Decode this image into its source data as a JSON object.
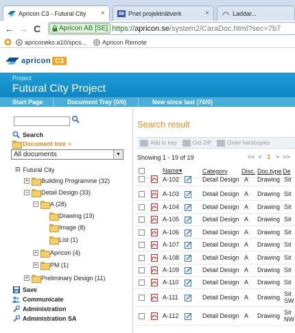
{
  "browser": {
    "tabs": [
      {
        "title": "Apricon C3 - Futural City",
        "close": "×",
        "active": true
      },
      {
        "title": "Pnet projektnätverk",
        "close": "×",
        "active": false
      },
      {
        "title": "Laddar...",
        "close": "",
        "active": false
      }
    ],
    "nav": {
      "back": "←",
      "forward": "→",
      "reload": "C"
    },
    "security_label": "Apricon AB [SE]",
    "url_prefix": "https://",
    "url_host": "apricon.se",
    "url_rest": "/system2/CaraDoc.html?sec=7b7",
    "bookmarks": [
      {
        "label": "apriconeko.a10/spcs..."
      },
      {
        "label": "Apricon Remote"
      }
    ]
  },
  "app": {
    "logo_word": "apricon",
    "logo_c3": "C3",
    "project_label": "Project",
    "project_title": "Futural City Project",
    "tabs": [
      {
        "label": "Start Page"
      },
      {
        "label": "Document Tray (0/0)"
      },
      {
        "label": "New since last (76/0)"
      }
    ],
    "colors": {
      "brand_blue": "#0f86c4",
      "accent_orange": "#e98d1a",
      "tab_blue": "#4aaed9"
    }
  },
  "left": {
    "search_label": "Search",
    "doc_tree_label": "Document tree",
    "doc_tree_chevron": "»",
    "filter_selected": "All documents",
    "tree": [
      {
        "label": "Futural City",
        "expander": "⊟",
        "folder": false
      },
      {
        "label": "Building Programme (32)",
        "expander": "+",
        "folder": true
      },
      {
        "label": "Detail Design (33)",
        "expander": "−",
        "folder": true
      },
      {
        "label": "A (28)",
        "expander": "−",
        "folder": true
      },
      {
        "label": "Drawing (19)",
        "expander": "",
        "folder": true
      },
      {
        "label": "Image (8)",
        "expander": "",
        "folder": true
      },
      {
        "label": "List (1)",
        "expander": "",
        "folder": true
      },
      {
        "label": "Apricon (4)",
        "expander": "+",
        "folder": true
      },
      {
        "label": "PM (1)",
        "expander": "+",
        "folder": true
      },
      {
        "label": "Preliminary Design (11)",
        "expander": "+",
        "folder": true
      }
    ],
    "actions": [
      {
        "label": "Save",
        "icon": "save-icon"
      },
      {
        "label": "Communicate",
        "icon": "people-icon"
      },
      {
        "label": "Administration",
        "icon": "wrench-icon"
      },
      {
        "label": "Administration SA",
        "icon": "wrench-icon"
      }
    ]
  },
  "results": {
    "title": "Search result",
    "toolbar": [
      {
        "label": "Add to tray",
        "icon": "tray-icon"
      },
      {
        "label": "Get ZIP",
        "icon": "zip-icon"
      },
      {
        "label": "Order hardcopies",
        "icon": "printer-icon"
      }
    ],
    "showing": "Showing 1 - 19 of 19",
    "pager": {
      "first": "<<",
      "prev": "<",
      "current": "1",
      "next": ">",
      "last": ">>"
    },
    "columns": {
      "name": "Name",
      "category": "Category",
      "disc": "Disc.",
      "doctype": "Doc.type",
      "desc": "De"
    },
    "sort_indicator": "▾",
    "rows": [
      {
        "name": "A-102",
        "category": "Detail Design",
        "disc": "A",
        "doctype": "Drawing",
        "desc": "Sit"
      },
      {
        "name": "A-103",
        "category": "Detail Design",
        "disc": "A",
        "doctype": "Drawing",
        "desc": "Sit"
      },
      {
        "name": "A-104",
        "category": "Detail Design",
        "disc": "A",
        "doctype": "Drawing",
        "desc": "Sit"
      },
      {
        "name": "A-105",
        "category": "Detail Design",
        "disc": "A",
        "doctype": "Drawing",
        "desc": "Sit"
      },
      {
        "name": "A-106",
        "category": "Detail Design",
        "disc": "A",
        "doctype": "Drawing",
        "desc": "Sit"
      },
      {
        "name": "A-107",
        "category": "Detail Design",
        "disc": "A",
        "doctype": "Drawing",
        "desc": "Sit"
      },
      {
        "name": "A-108",
        "category": "Detail Design",
        "disc": "A",
        "doctype": "Drawing",
        "desc": "Sit"
      },
      {
        "name": "A-109",
        "category": "Detail Design",
        "disc": "A",
        "doctype": "Drawing",
        "desc": "Sit"
      },
      {
        "name": "A-110",
        "category": "Detail Design",
        "disc": "A",
        "doctype": "Drawing",
        "desc": "Sit"
      },
      {
        "name": "A-111",
        "category": "Detail Design",
        "disc": "A",
        "doctype": "Drawing",
        "desc": "Sit SW"
      },
      {
        "name": "A-112",
        "category": "Detail Design",
        "disc": "A",
        "doctype": "Drawing",
        "desc": "Sit NW"
      }
    ]
  }
}
